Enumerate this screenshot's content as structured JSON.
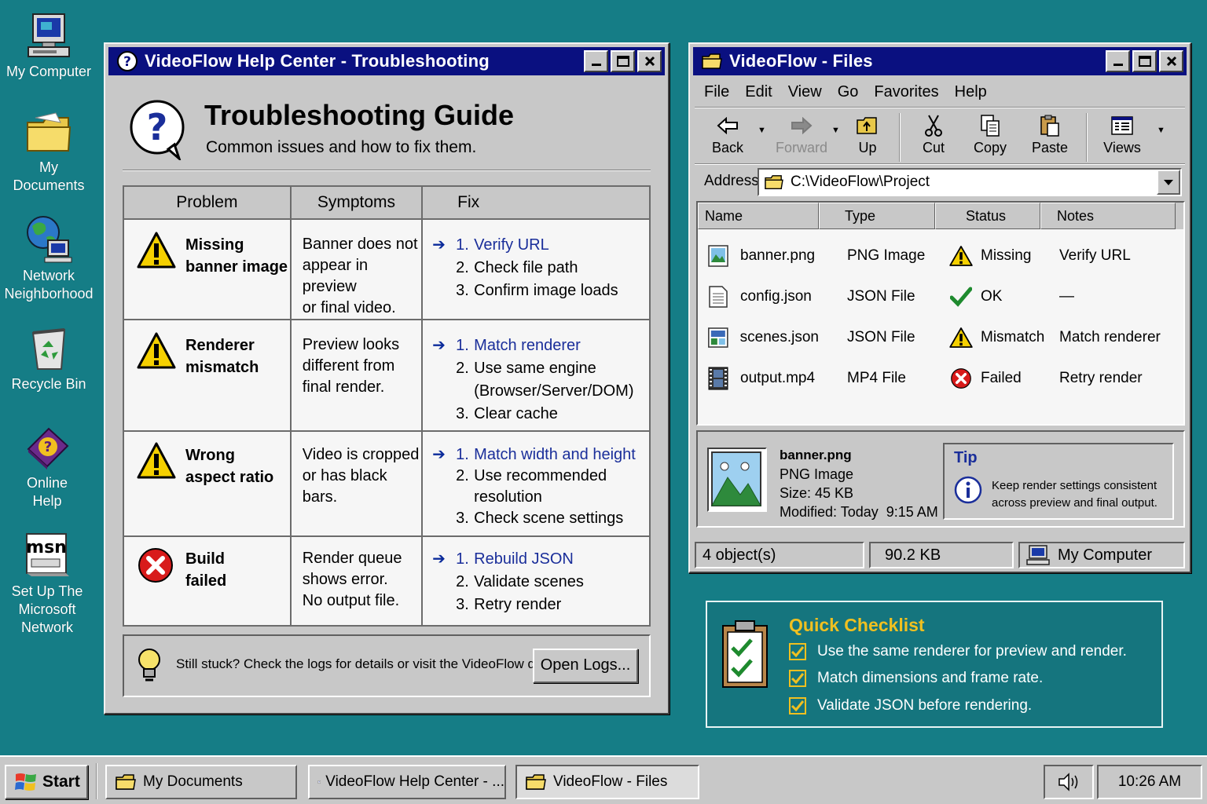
{
  "desktop": {
    "icons": [
      {
        "label_lines": [
          "My Computer"
        ]
      },
      {
        "label_lines": [
          "My Documents"
        ]
      },
      {
        "label_lines": [
          "Network",
          "Neighborhood"
        ]
      },
      {
        "label_lines": [
          "Recycle Bin"
        ]
      },
      {
        "label_lines": [
          "Online",
          "Help"
        ]
      },
      {
        "label_lines": [
          "Set Up The",
          "Microsoft",
          "Network"
        ]
      }
    ]
  },
  "help_window": {
    "title": "VideoFlow Help Center - Troubleshooting",
    "heading": "Troubleshooting Guide",
    "subheading": "Common issues and how to fix them.",
    "columns": [
      "Problem",
      "Symptoms",
      "Fix"
    ],
    "rows": [
      {
        "icon": "warning-icon",
        "problem_lines": [
          "Missing",
          "banner image"
        ],
        "symptom_lines": [
          "Banner does not",
          "appear in preview",
          "or final video."
        ],
        "fixes": [
          {
            "num": "1.",
            "text": "Verify URL"
          },
          {
            "num": "2.",
            "text": "Check file path"
          },
          {
            "num": "3.",
            "text": "Confirm image loads"
          }
        ]
      },
      {
        "icon": "warning-icon",
        "problem_lines": [
          "Renderer",
          "mismatch"
        ],
        "symptom_lines": [
          "Preview looks",
          "different from",
          "final render."
        ],
        "fixes": [
          {
            "num": "1.",
            "text": "Match renderer"
          },
          {
            "num": "2.",
            "text": "Use same engine",
            "extra": "(Browser/Server/DOM)"
          },
          {
            "num": "3.",
            "text": "Clear cache"
          }
        ]
      },
      {
        "icon": "warning-icon",
        "problem_lines": [
          "Wrong",
          "aspect ratio"
        ],
        "symptom_lines": [
          "Video is cropped",
          "or has black",
          "bars."
        ],
        "fixes": [
          {
            "num": "1.",
            "text": "Match width and height"
          },
          {
            "num": "2.",
            "text": "Use recommended",
            "extra": "resolution"
          },
          {
            "num": "3.",
            "text": "Check scene settings"
          }
        ]
      },
      {
        "icon": "error-icon",
        "problem_lines": [
          "Build",
          "failed"
        ],
        "symptom_lines": [
          "Render queue",
          "shows error.",
          "No output file."
        ],
        "fixes": [
          {
            "num": "1.",
            "text": "Rebuild JSON"
          },
          {
            "num": "2.",
            "text": "Validate scenes"
          },
          {
            "num": "3.",
            "text": "Retry render"
          }
        ]
      }
    ],
    "footer_text": "Still stuck? Check the logs for details or visit the VideoFlow docs.",
    "open_logs_label": "Open Logs..."
  },
  "files_window": {
    "title": "VideoFlow - Files",
    "menu": [
      "File",
      "Edit",
      "View",
      "Go",
      "Favorites",
      "Help"
    ],
    "toolbar": {
      "back": "Back",
      "forward": "Forward",
      "up": "Up",
      "cut": "Cut",
      "copy": "Copy",
      "paste": "Paste",
      "views": "Views"
    },
    "address_label": "Address",
    "address_value": "C:\\VideoFlow\\Project",
    "columns": [
      "Name",
      "Type",
      "Status",
      "Notes"
    ],
    "files": [
      {
        "name": "banner.png",
        "type": "PNG Image",
        "status": "Missing",
        "status_icon": "warning-icon",
        "notes": "Verify URL"
      },
      {
        "name": "config.json",
        "type": "JSON File",
        "status": "OK",
        "status_icon": "check-icon",
        "notes": "—"
      },
      {
        "name": "scenes.json",
        "type": "JSON File",
        "status": "Mismatch",
        "status_icon": "warning-icon",
        "notes": "Match renderer"
      },
      {
        "name": "output.mp4",
        "type": "MP4 File",
        "status": "Failed",
        "status_icon": "error-icon",
        "notes": "Retry render"
      }
    ],
    "details": {
      "name": "banner.png",
      "type": "PNG Image",
      "size": "Size: 45 KB",
      "modified": "Modified: Today  9:15 AM"
    },
    "tip": {
      "title": "Tip",
      "lines": [
        "Keep render settings consistent",
        "across preview and final output."
      ]
    },
    "status_bar": {
      "count": "4 object(s)",
      "size": "90.2 KB",
      "location": "My Computer"
    }
  },
  "checklist": {
    "title": "Quick Checklist",
    "items": [
      "Use the same renderer for preview and render.",
      "Match dimensions and frame rate.",
      "Validate JSON before rendering."
    ]
  },
  "taskbar": {
    "start_label": "Start",
    "buttons": [
      "My Documents",
      "VideoFlow Help Center - ...",
      "VideoFlow - Files"
    ],
    "clock": "10:26 AM"
  },
  "colors": {
    "desktop": "#157d86",
    "title_active": "#0a1080",
    "fix_link": "#1a2e9a",
    "checklist_title": "#f0c020",
    "warning": "#f5d000",
    "error": "#d81b1b",
    "ok": "#1e8a2e"
  }
}
